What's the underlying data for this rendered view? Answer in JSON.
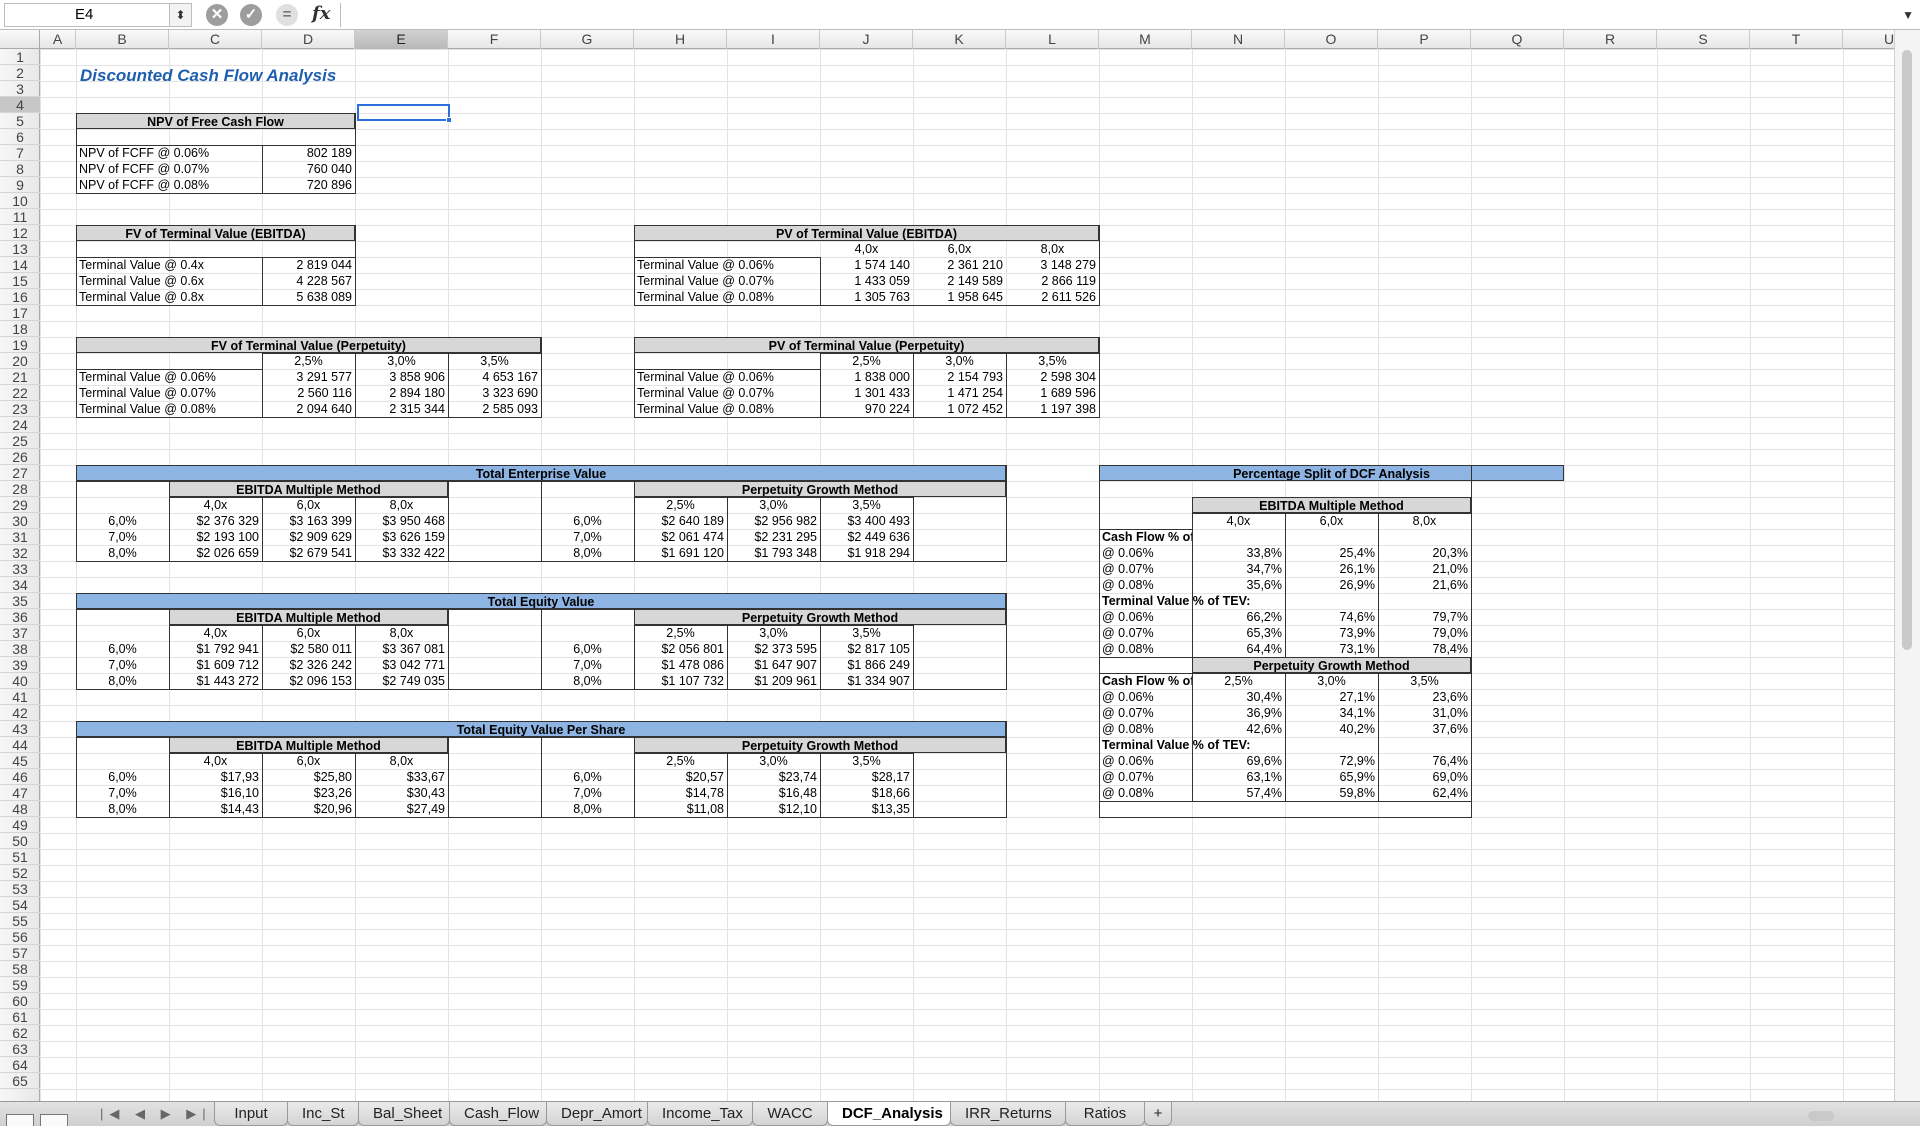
{
  "formula_bar": {
    "name_box": "E4",
    "fx_label": "fx",
    "formula": ""
  },
  "columns": [
    "A",
    "B",
    "C",
    "D",
    "E",
    "F",
    "G",
    "H",
    "I",
    "J",
    "K",
    "L",
    "M",
    "N",
    "O",
    "P",
    "Q",
    "R",
    "S",
    "T",
    "U"
  ],
  "selected_column": "E",
  "selected_row": "4",
  "sheet": {
    "title": "Discounted Cash Flow Analysis",
    "npv": {
      "header": "NPV of Free Cash Flow",
      "rows": [
        [
          "NPV of FCFF @ 0.06%",
          "802 189"
        ],
        [
          "NPV of FCFF @ 0.07%",
          "760 040"
        ],
        [
          "NPV of FCFF @ 0.08%",
          "720 896"
        ]
      ]
    },
    "fv_tv_ebitda": {
      "header": "FV of Terminal Value (EBITDA)",
      "rows": [
        [
          "Terminal Value @ 0.4x",
          "2 819 044"
        ],
        [
          "Terminal Value @ 0.6x",
          "4 228 567"
        ],
        [
          "Terminal Value @ 0.8x",
          "5 638 089"
        ]
      ]
    },
    "pv_tv_ebitda": {
      "header": "PV of Terminal Value (EBITDA)",
      "cols": [
        "4,0x",
        "6,0x",
        "8,0x"
      ],
      "rows": [
        [
          "Terminal Value @ 0.06%",
          "1 574 140",
          "2 361 210",
          "3 148 279"
        ],
        [
          "Terminal Value @ 0.07%",
          "1 433 059",
          "2 149 589",
          "2 866 119"
        ],
        [
          "Terminal Value @ 0.08%",
          "1 305 763",
          "1 958 645",
          "2 611 526"
        ]
      ]
    },
    "fv_tv_perp": {
      "header": "FV of Terminal Value (Perpetuity)",
      "cols": [
        "2,5%",
        "3,0%",
        "3,5%"
      ],
      "rows": [
        [
          "Terminal Value @ 0.06%",
          "3 291 577",
          "3 858 906",
          "4 653 167"
        ],
        [
          "Terminal Value @ 0.07%",
          "2 560 116",
          "2 894 180",
          "3 323 690"
        ],
        [
          "Terminal Value @ 0.08%",
          "2 094 640",
          "2 315 344",
          "2 585 093"
        ]
      ]
    },
    "pv_tv_perp": {
      "header": "PV of Terminal Value (Perpetuity)",
      "cols": [
        "2,5%",
        "3,0%",
        "3,5%"
      ],
      "rows": [
        [
          "Terminal Value @ 0.06%",
          "1 838 000",
          "2 154 793",
          "2 598 304"
        ],
        [
          "Terminal Value @ 0.07%",
          "1 301 433",
          "1 471 254",
          "1 689 596"
        ],
        [
          "Terminal Value @ 0.08%",
          "970 224",
          "1 072 452",
          "1 197 398"
        ]
      ]
    },
    "tev": {
      "header": "Total Enterprise Value",
      "left_header": "EBITDA Multiple Method",
      "left_cols": [
        "4,0x",
        "6,0x",
        "8,0x"
      ],
      "right_header": "Perpetuity Growth Method",
      "right_cols": [
        "2,5%",
        "3,0%",
        "3,5%"
      ],
      "rates": [
        "6,0%",
        "7,0%",
        "8,0%"
      ],
      "left": [
        [
          "$2 376 329",
          "$3 163 399",
          "$3 950 468"
        ],
        [
          "$2 193 100",
          "$2 909 629",
          "$3 626 159"
        ],
        [
          "$2 026 659",
          "$2 679 541",
          "$3 332 422"
        ]
      ],
      "right": [
        [
          "$2 640 189",
          "$2 956 982",
          "$3 400 493"
        ],
        [
          "$2 061 474",
          "$2 231 295",
          "$2 449 636"
        ],
        [
          "$1 691 120",
          "$1 793 348",
          "$1 918 294"
        ]
      ]
    },
    "tequity": {
      "header": "Total Equity Value",
      "left_header": "EBITDA Multiple Method",
      "left_cols": [
        "4,0x",
        "6,0x",
        "8,0x"
      ],
      "right_header": "Perpetuity Growth Method",
      "right_cols": [
        "2,5%",
        "3,0%",
        "3,5%"
      ],
      "rates": [
        "6,0%",
        "7,0%",
        "8,0%"
      ],
      "left": [
        [
          "$1 792 941",
          "$2 580 011",
          "$3 367 081"
        ],
        [
          "$1 609 712",
          "$2 326 242",
          "$3 042 771"
        ],
        [
          "$1 443 272",
          "$2 096 153",
          "$2 749 035"
        ]
      ],
      "right": [
        [
          "$2 056 801",
          "$2 373 595",
          "$2 817 105"
        ],
        [
          "$1 478 086",
          "$1 647 907",
          "$1 866 249"
        ],
        [
          "$1 107 732",
          "$1 209 961",
          "$1 334 907"
        ]
      ]
    },
    "teps": {
      "header": "Total Equity Value Per Share",
      "left_header": "EBITDA Multiple Method",
      "left_cols": [
        "4,0x",
        "6,0x",
        "8,0x"
      ],
      "right_header": "Perpetuity Growth Method",
      "right_cols": [
        "2,5%",
        "3,0%",
        "3,5%"
      ],
      "rates": [
        "6,0%",
        "7,0%",
        "8,0%"
      ],
      "left": [
        [
          "$17,93",
          "$25,80",
          "$33,67"
        ],
        [
          "$16,10",
          "$23,26",
          "$30,43"
        ],
        [
          "$14,43",
          "$20,96",
          "$27,49"
        ]
      ],
      "right": [
        [
          "$20,57",
          "$23,74",
          "$28,17"
        ],
        [
          "$14,78",
          "$16,48",
          "$18,66"
        ],
        [
          "$11,08",
          "$12,10",
          "$13,35"
        ]
      ]
    },
    "split": {
      "header": "Percentage Split of DCF Analysis",
      "ebitda": {
        "header": "EBITDA Multiple Method",
        "cols": [
          "4,0x",
          "6,0x",
          "8,0x"
        ],
        "cf_label": "Cash Flow % of TEV:",
        "cf_rows": [
          [
            "@ 0.06%",
            "33,8%",
            "25,4%",
            "20,3%"
          ],
          [
            "@ 0.07%",
            "34,7%",
            "26,1%",
            "21,0%"
          ],
          [
            "@ 0.08%",
            "35,6%",
            "26,9%",
            "21,6%"
          ]
        ],
        "tv_label": "Terminal Value % of TEV:",
        "tv_rows": [
          [
            "@ 0.06%",
            "66,2%",
            "74,6%",
            "79,7%"
          ],
          [
            "@ 0.07%",
            "65,3%",
            "73,9%",
            "79,0%"
          ],
          [
            "@ 0.08%",
            "64,4%",
            "73,1%",
            "78,4%"
          ]
        ]
      },
      "perp": {
        "header": "Perpetuity Growth Method",
        "cols": [
          "2,5%",
          "3,0%",
          "3,5%"
        ],
        "cf_label": "Cash Flow % of TEV:",
        "cf_rows": [
          [
            "@ 0.06%",
            "30,4%",
            "27,1%",
            "23,6%"
          ],
          [
            "@ 0.07%",
            "36,9%",
            "34,1%",
            "31,0%"
          ],
          [
            "@ 0.08%",
            "42,6%",
            "40,2%",
            "37,6%"
          ]
        ],
        "tv_label": "Terminal Value % of TEV:",
        "tv_rows": [
          [
            "@ 0.06%",
            "69,6%",
            "72,9%",
            "76,4%"
          ],
          [
            "@ 0.07%",
            "63,1%",
            "65,9%",
            "69,0%"
          ],
          [
            "@ 0.08%",
            "57,4%",
            "59,8%",
            "62,4%"
          ]
        ]
      }
    }
  },
  "tabs": [
    {
      "label": "Input",
      "active": false
    },
    {
      "label": "Inc_St",
      "active": false
    },
    {
      "label": "Bal_Sheet",
      "active": false
    },
    {
      "label": "Cash_Flow",
      "active": false
    },
    {
      "label": "Depr_Amort",
      "active": false
    },
    {
      "label": "Income_Tax",
      "active": false
    },
    {
      "label": "WACC",
      "active": false
    },
    {
      "label": "DCF_Analysis",
      "active": true
    },
    {
      "label": "IRR_Returns",
      "active": false
    },
    {
      "label": "Ratios",
      "active": false
    }
  ],
  "add_tab_label": "+",
  "tab_nav_label": "|◀ ◀ ▶ ▶|"
}
